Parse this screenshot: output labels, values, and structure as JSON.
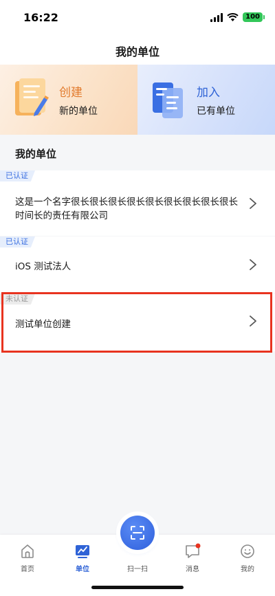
{
  "status_bar": {
    "time": "16:22",
    "battery": "100"
  },
  "nav": {
    "title": "我的单位"
  },
  "actions": {
    "create": {
      "title": "创建",
      "subtitle": "新的单位",
      "icon": "document-pen-icon"
    },
    "join": {
      "title": "加入",
      "subtitle": "已有单位",
      "icon": "documents-icon"
    }
  },
  "section": {
    "title": "我的单位"
  },
  "units": [
    {
      "badge": "已认证",
      "verified": true,
      "name": "这是一个名字很长很长很长很长很长很长很长很长很长时间长的责任有限公司"
    },
    {
      "badge": "已认证",
      "verified": true,
      "name": "iOS 测试法人"
    },
    {
      "badge": "未认证",
      "verified": false,
      "name": "测试单位创建"
    }
  ],
  "tabs": [
    {
      "label": "首页",
      "icon": "home-icon"
    },
    {
      "label": "单位",
      "icon": "chart-board-icon",
      "active": true
    },
    {
      "label": "扫一扫",
      "icon": "scan-icon"
    },
    {
      "label": "消息",
      "icon": "message-icon",
      "badge": true
    },
    {
      "label": "我的",
      "icon": "smile-icon"
    }
  ],
  "colors": {
    "accent": "#2f63d6",
    "create": "#e27a2c",
    "highlight": "#e8331f"
  }
}
